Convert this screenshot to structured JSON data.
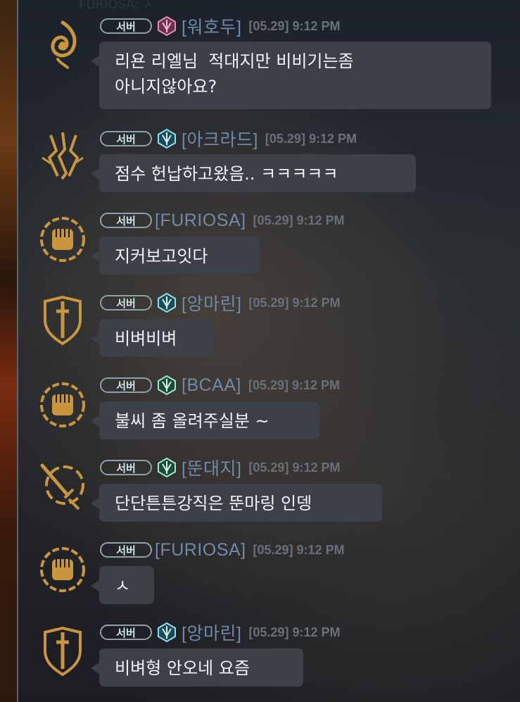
{
  "background_hint": "FURIOSA: ㅅ",
  "colors": {
    "bubble": "#3c4047",
    "name": "#6f8ba7",
    "time": "#69707a",
    "badge_border": "#8ea1a8",
    "gold_icon": "#c9963e"
  },
  "messages": [
    {
      "badge": "서버",
      "emblem": "pink-guild-emblem",
      "name": "[워호두]",
      "time": "[05.29] 9:12 PM",
      "avatar": "flame-swirl-icon",
      "lines": [
        "리욘 리엘님  적대지만 비비기는좀",
        "아니지않아요?"
      ]
    },
    {
      "badge": "서버",
      "emblem": "cyan-guild-emblem",
      "name": "[아크라드]",
      "time": "[05.29] 9:12 PM",
      "avatar": "lightning-claw-icon",
      "lines": [
        "점수 헌납하고왔음.. ㅋㅋㅋㅋㅋ"
      ]
    },
    {
      "badge": "서버",
      "emblem": "",
      "name": "[FURIOSA]",
      "time": "[05.29] 9:12 PM",
      "avatar": "fist-emblem-icon",
      "lines": [
        "지커보고잇다"
      ]
    },
    {
      "badge": "서버",
      "emblem": "cyan-guild-emblem",
      "name": "[앙마린]",
      "time": "[05.29] 9:12 PM",
      "avatar": "sword-shield-icon",
      "lines": [
        "비벼비벼"
      ]
    },
    {
      "badge": "서버",
      "emblem": "green-guild-emblem",
      "name": "[BCAA]",
      "time": "[05.29] 9:12 PM",
      "avatar": "fist-emblem-icon",
      "lines": [
        "불씨 좀 올려주실분 ~"
      ]
    },
    {
      "badge": "서버",
      "emblem": "green-guild-emblem",
      "name": "[뚠대지]",
      "time": "[05.29] 9:12 PM",
      "avatar": "dagger-ring-icon",
      "lines": [
        "단단튼튼강직은 뚠마링 인뎅"
      ]
    },
    {
      "badge": "서버",
      "emblem": "",
      "name": "[FURIOSA]",
      "time": "[05.29] 9:12 PM",
      "avatar": "fist-emblem-icon",
      "lines": [
        "ㅅ"
      ]
    },
    {
      "badge": "서버",
      "emblem": "cyan-guild-emblem",
      "name": "[앙마린]",
      "time": "[05.29] 9:12 PM",
      "avatar": "sword-shield-icon",
      "lines": [
        "비벼형 안오네 요즘"
      ]
    }
  ]
}
